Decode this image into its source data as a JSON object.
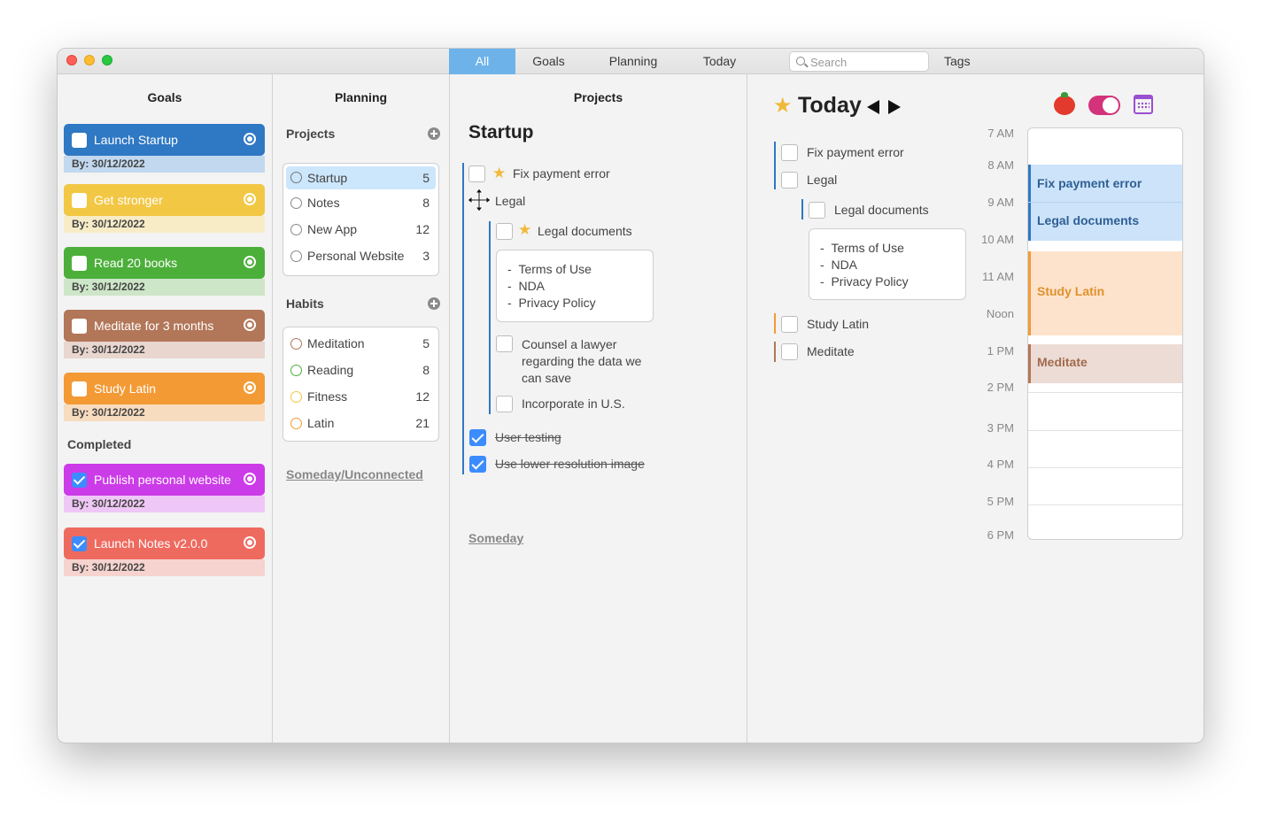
{
  "tabs": [
    {
      "label": "All",
      "active": true
    },
    {
      "label": "Goals",
      "active": false
    },
    {
      "label": "Planning",
      "active": false
    },
    {
      "label": "Today",
      "active": false
    }
  ],
  "search": {
    "placeholder": "Search"
  },
  "tags_label": "Tags",
  "goals": {
    "title": "Goals",
    "active": [
      {
        "title": "Launch Startup",
        "due": "By: 30/12/2022",
        "color": "#2f78c4",
        "due_bg": "#c2d8ee",
        "checked": false
      },
      {
        "title": "Get stronger",
        "due": "By: 30/12/2022",
        "color": "#f2c744",
        "due_bg": "#f8ecc7",
        "checked": false
      },
      {
        "title": "Read 20 books",
        "due": "By: 30/12/2022",
        "color": "#4caf3a",
        "due_bg": "#cde6c8",
        "checked": false
      },
      {
        "title": "Meditate for 3 months",
        "due": "By: 30/12/2022",
        "color": "#b27658",
        "due_bg": "#e9d6cf",
        "checked": false
      },
      {
        "title": "Study Latin",
        "due": "By: 30/12/2022",
        "color": "#f39a35",
        "due_bg": "#f8dcbf",
        "checked": false
      }
    ],
    "completed_label": "Completed",
    "completed": [
      {
        "title": "Publish personal website",
        "due": "By: 30/12/2022",
        "color": "#cc3be8",
        "due_bg": "#efc7f6",
        "checked": true
      },
      {
        "title": "Launch Notes v2.0.0",
        "due": "By: 30/12/2022",
        "color": "#ee6a5f",
        "due_bg": "#f6d3cf",
        "checked": true
      }
    ]
  },
  "planning": {
    "title": "Planning",
    "projects_label": "Projects",
    "projects": [
      {
        "name": "Startup",
        "count": "5"
      },
      {
        "name": "Notes",
        "count": "8"
      },
      {
        "name": "New App",
        "count": "12"
      },
      {
        "name": "Personal Website",
        "count": "3"
      }
    ],
    "habits_label": "Habits",
    "habits": [
      {
        "name": "Meditation",
        "count": "5",
        "ring": "#b27658"
      },
      {
        "name": "Reading",
        "count": "8",
        "ring": "#4caf3a"
      },
      {
        "name": "Fitness",
        "count": "12",
        "ring": "#f2c744"
      },
      {
        "name": "Latin",
        "count": "21",
        "ring": "#f39a35"
      }
    ],
    "someday_link": "Someday/Unconnected"
  },
  "projects": {
    "title": "Projects",
    "project_name": "Startup",
    "tasks": {
      "fix": "Fix payment error",
      "legal": "Legal",
      "legal_docs": "Legal documents",
      "notes": [
        "Terms of Use",
        "NDA",
        "Privacy Policy"
      ],
      "counsel": [
        "Counsel a lawyer",
        "regarding the data we",
        "can save"
      ],
      "incorporate": "Incorporate in U.S.",
      "user_testing": "User testing",
      "lower_res": "Use lower resolution image"
    },
    "someday_link": "Someday"
  },
  "today": {
    "title": "Today",
    "tasks": {
      "fix": "Fix payment error",
      "legal": "Legal",
      "legal_docs": "Legal documents",
      "notes": [
        "Terms of Use",
        "NDA",
        "Privacy Policy"
      ],
      "study": "Study Latin",
      "meditate": "Meditate"
    },
    "hours": [
      "7 AM",
      "8 AM",
      "9 AM",
      "10 AM",
      "11 AM",
      "Noon",
      "1 PM",
      "2 PM",
      "3 PM",
      "4 PM",
      "5 PM",
      "6 PM"
    ],
    "events": {
      "fix": "Fix payment error",
      "legal": "Legal documents",
      "latin": "Study Latin",
      "meditate": "Meditate"
    }
  },
  "colors": {
    "accent": "#6db3ea",
    "startup": "#2f78c4",
    "latin": "#f39a35",
    "meditate": "#b27658"
  }
}
